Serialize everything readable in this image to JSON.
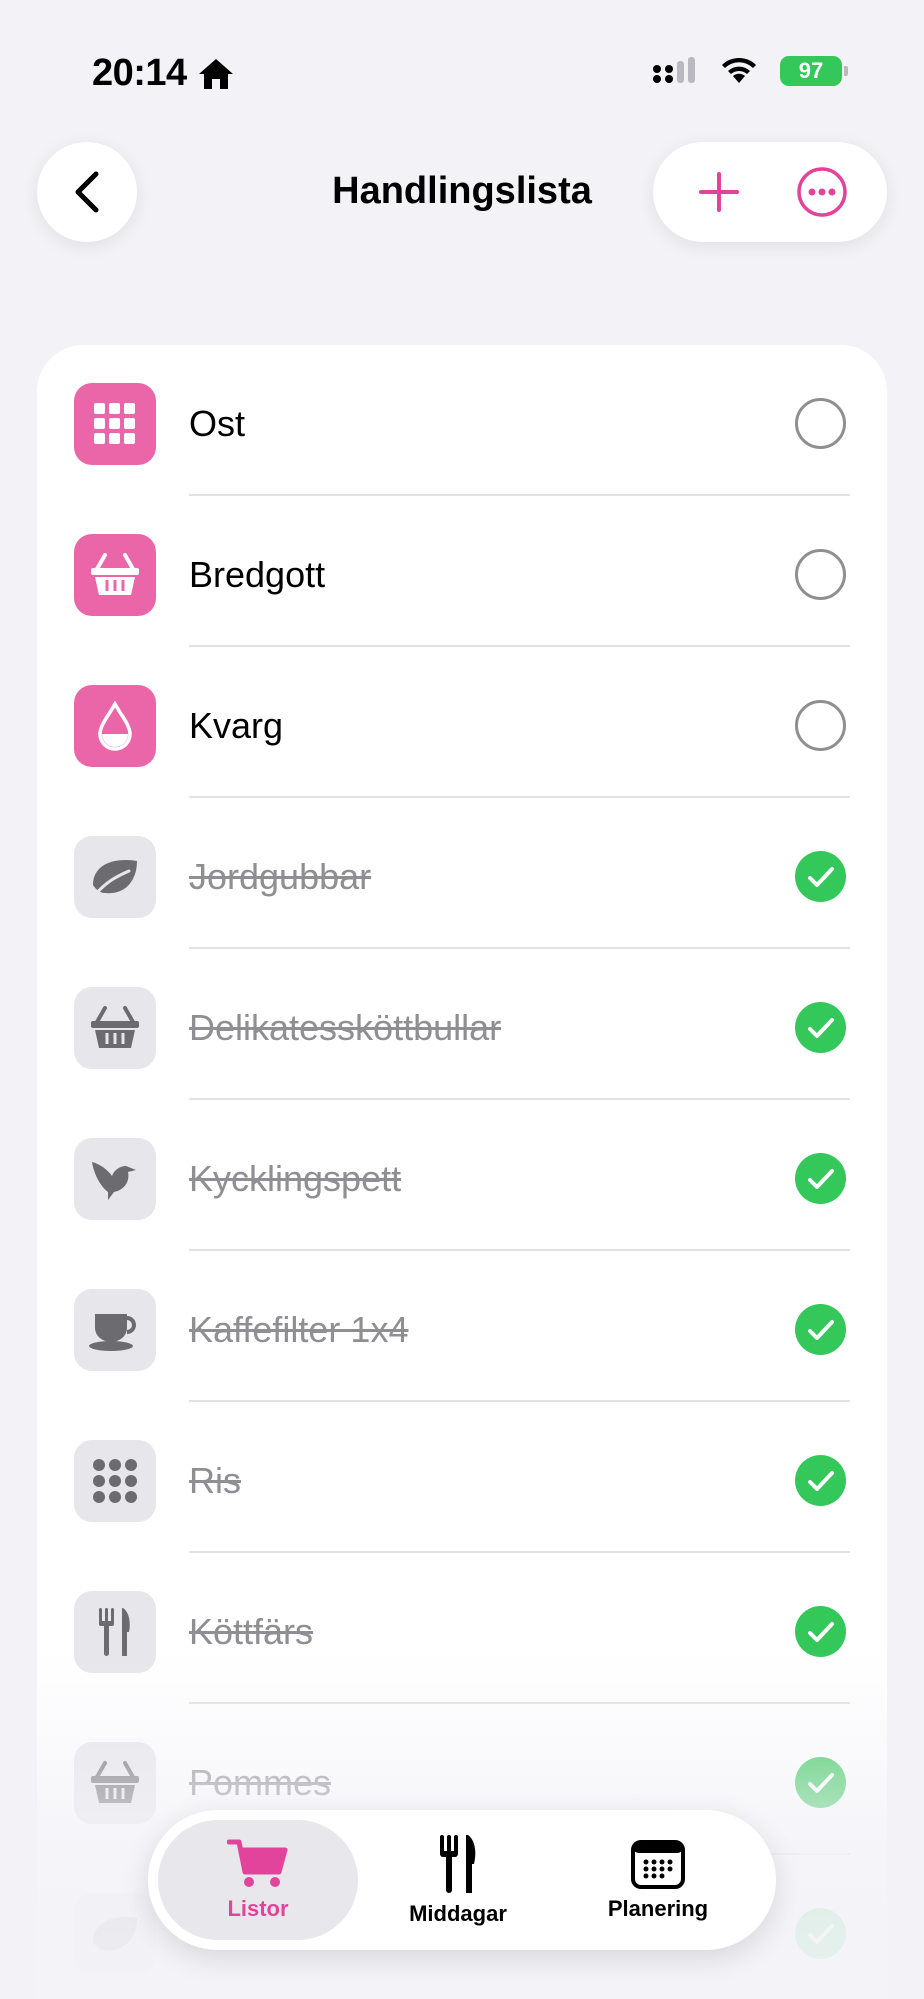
{
  "status_bar": {
    "time": "20:14",
    "battery": "97"
  },
  "header": {
    "title": "Handlingslista"
  },
  "colors": {
    "accent": "#e2439b",
    "check": "#34c759",
    "tile_active": "#ea66a8",
    "tile_done": "#e6e6eb"
  },
  "items": [
    {
      "label": "Ost",
      "icon": "grid-icon",
      "checked": false
    },
    {
      "label": "Bredgott",
      "icon": "basket-icon",
      "checked": false
    },
    {
      "label": "Kvarg",
      "icon": "drop-icon",
      "checked": false
    },
    {
      "label": "Jordgubbar",
      "icon": "leaf-icon",
      "checked": true
    },
    {
      "label": "Delikatessköttbullar",
      "icon": "basket-icon",
      "checked": true
    },
    {
      "label": "Kycklingspett",
      "icon": "bird-icon",
      "checked": true
    },
    {
      "label": "Kaffefilter 1x4",
      "icon": "cup-icon",
      "checked": true
    },
    {
      "label": "Ris",
      "icon": "dots-icon",
      "checked": true
    },
    {
      "label": "Köttfärs",
      "icon": "fork-knife-icon",
      "checked": true
    },
    {
      "label": "Pommes",
      "icon": "basket-icon",
      "checked": true
    }
  ],
  "tabs": [
    {
      "label": "Listor",
      "icon": "cart-icon",
      "active": true
    },
    {
      "label": "Middagar",
      "icon": "fork-knife-icon",
      "active": false
    },
    {
      "label": "Planering",
      "icon": "calendar-icon",
      "active": false
    }
  ]
}
